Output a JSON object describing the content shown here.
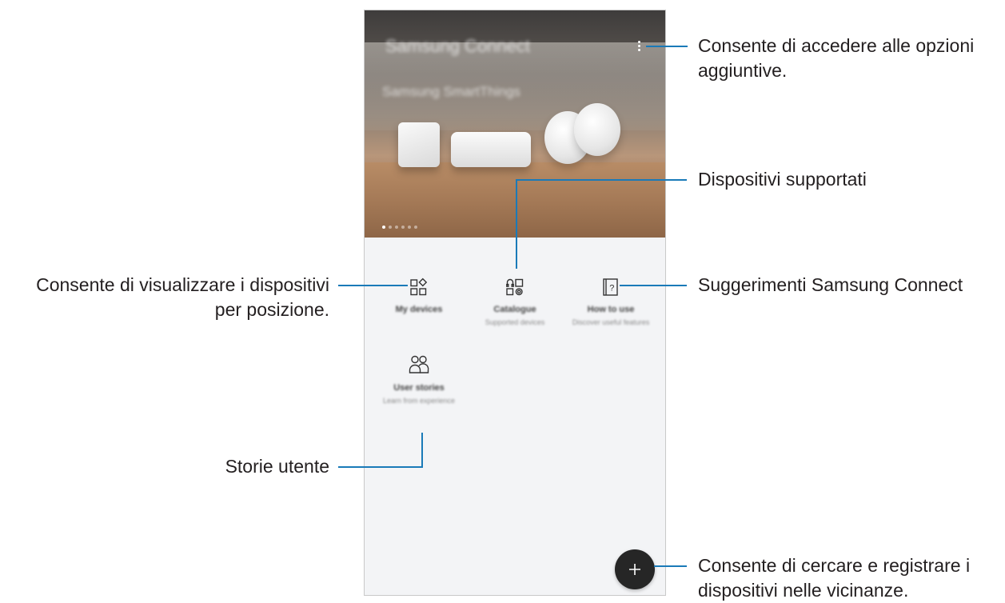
{
  "hero": {
    "brand_title": "Samsung Connect",
    "subtitle": "Samsung SmartThings",
    "page_indicator": {
      "count": 6,
      "active_index": 0
    }
  },
  "menu": [
    {
      "title": "My devices",
      "subtitle": "",
      "icon": "grid-diamond-icon"
    },
    {
      "title": "Catalogue",
      "subtitle": "Supported devices",
      "icon": "catalogue-devices-icon"
    },
    {
      "title": "How to use",
      "subtitle": "Discover useful features",
      "icon": "help-book-icon"
    },
    {
      "title": "User stories",
      "subtitle": "Learn from experience",
      "icon": "people-icon"
    }
  ],
  "fab": {
    "icon": "plus-icon"
  },
  "callouts": {
    "more_options": "Consente di accedere alle opzioni aggiuntive.",
    "more_options_line1": "Consente di accedere alle opzioni",
    "more_options_line2": "aggiuntive.",
    "supported_devices": "Dispositivi supportati",
    "my_devices_line1": "Consente di visualizzare i dispositivi",
    "my_devices_line2": "per posizione.",
    "tips": "Suggerimenti Samsung Connect",
    "user_stories": "Storie utente",
    "add_device_line1": "Consente di cercare e registrare i",
    "add_device_line2": "dispositivi nelle vicinanze."
  },
  "colors": {
    "callout_line": "#1a7ab8",
    "fab": "#262626",
    "screen_bg": "#f3f4f6"
  }
}
